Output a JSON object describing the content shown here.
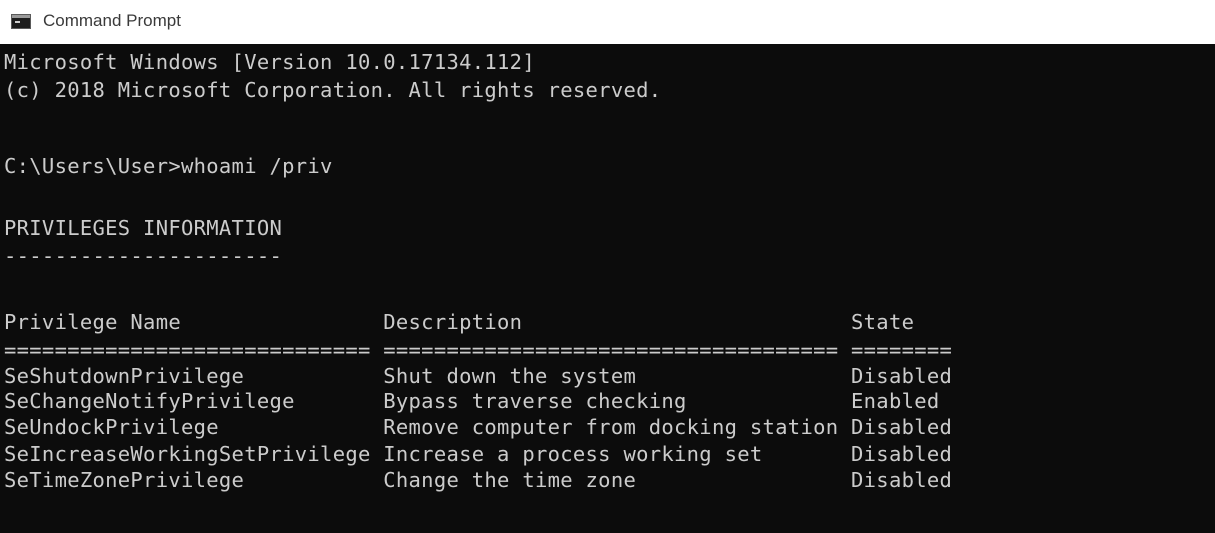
{
  "window": {
    "title": "Command Prompt",
    "icon": "cmd-icon"
  },
  "console": {
    "lines": [
      "Microsoft Windows [Version 10.0.17134.112]",
      "(c) 2018 Microsoft Corporation. All rights reserved.",
      "",
      "C:\\Users\\User>whoami /priv",
      "",
      "PRIVILEGES INFORMATION",
      "----------------------",
      "",
      "Privilege Name                Description                          State",
      "============================= ==================================== ========",
      "SeShutdownPrivilege           Shut down the system                 Disabled",
      "SeChangeNotifyPrivilege       Bypass traverse checking             Enabled",
      "SeUndockPrivilege             Remove computer from docking station Disabled",
      "SeIncreaseWorkingSetPrivilege Increase a process working set       Disabled",
      "SeTimeZonePrivilege           Change the time zone                 Disabled"
    ]
  },
  "colors": {
    "console_background": "#0c0c0c",
    "console_text": "#cccccc",
    "titlebar_background": "#ffffff"
  }
}
